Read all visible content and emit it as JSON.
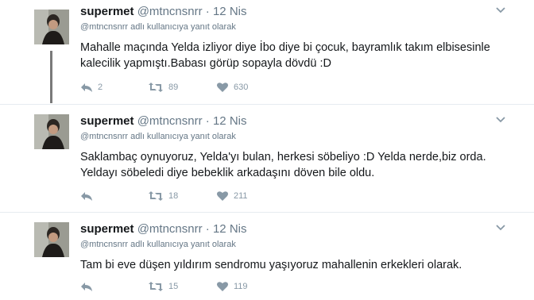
{
  "tweets": [
    {
      "name": "supermet",
      "handle": "@mtncnsnrr",
      "separator": "·",
      "date": "12 Nis",
      "reply_mention": "@mtncnsnrr",
      "reply_suffix": "adlı kullanıcıya yanıt olarak",
      "text": "Mahalle maçında Yelda izliyor diye İbo diye bi çocuk, bayramlık takım elbisesinle kalecilik yapmıştı.Babası görüp sopayla dövdü :D",
      "replies": "2",
      "retweets": "89",
      "likes": "630"
    },
    {
      "name": "supermet",
      "handle": "@mtncnsnrr",
      "separator": "·",
      "date": "12 Nis",
      "reply_mention": "@mtncnsnrr",
      "reply_suffix": "adlı kullanıcıya yanıt olarak",
      "text": "Saklambaç oynuyoruz, Yelda'yı bulan, herkesi söbeliyo :D Yelda nerde,biz orda. Yeldayı söbeledi diye bebeklik arkadaşını döven bile oldu.",
      "replies": "",
      "retweets": "18",
      "likes": "211"
    },
    {
      "name": "supermet",
      "handle": "@mtncnsnrr",
      "separator": "·",
      "date": "12 Nis",
      "reply_mention": "@mtncnsnrr",
      "reply_suffix": "adlı kullanıcıya yanıt olarak",
      "text": "Tam bi eve düşen yıldırım sendromu yaşıyoruz mahallenin erkekleri olarak.",
      "replies": "",
      "retweets": "15",
      "likes": "119"
    }
  ],
  "icons": {
    "reply": "reply-icon",
    "retweet": "retweet-icon",
    "like": "heart-icon",
    "menu": "chevron-down-icon"
  },
  "colors": {
    "text": "#14171a",
    "secondary": "#657786",
    "action": "#8899a6",
    "divider": "#e6ecf0"
  }
}
